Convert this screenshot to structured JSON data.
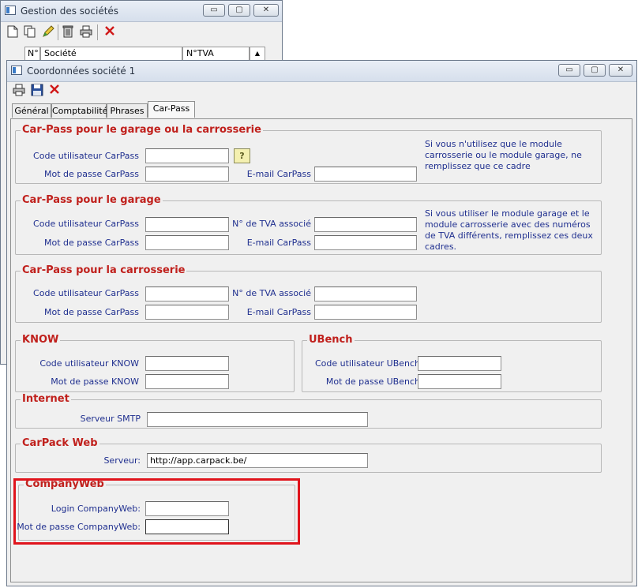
{
  "back_window": {
    "title": "Gestion des sociétés",
    "controls": {
      "minimize": "▭",
      "maximize": "▢",
      "close": "✕"
    },
    "grid_headers": [
      "N°",
      "Société",
      "N°TVA"
    ]
  },
  "front_window": {
    "title": "Coordonnées société 1",
    "controls": {
      "minimize": "▭",
      "maximize": "▢",
      "close": "✕"
    },
    "tabs": [
      {
        "label": "Général"
      },
      {
        "label": "Comptabilité"
      },
      {
        "label": "Phrases"
      },
      {
        "label": "Car-Pass",
        "active": true
      }
    ],
    "groups": {
      "carpass_both": {
        "title": "Car-Pass pour le garage ou la carrosserie",
        "user_label": "Code utilisateur CarPass",
        "user_value": "",
        "password_label": "Mot de passe CarPass",
        "password_value": "",
        "email_label": "E-mail CarPass",
        "email_value": "",
        "help_button": "?",
        "note": "Si vous n'utilisez que le module carrosserie ou le module garage, ne remplissez que ce cadre"
      },
      "carpass_garage": {
        "title": "Car-Pass pour le garage",
        "user_label": "Code utilisateur CarPass",
        "user_value": "",
        "password_label": "Mot de passe CarPass",
        "password_value": "",
        "vat_label": "N° de TVA associé",
        "vat_value": "",
        "email_label": "E-mail CarPass",
        "email_value": "",
        "note": "Si vous utiliser le module garage et le module carrosserie avec des numéros de TVA différents, remplissez ces deux cadres."
      },
      "carpass_body": {
        "title": "Car-Pass pour la carrosserie",
        "user_label": "Code utilisateur CarPass",
        "user_value": "",
        "password_label": "Mot de passe CarPass",
        "password_value": "",
        "vat_label": "N° de TVA associé",
        "vat_value": "",
        "email_label": "E-mail CarPass",
        "email_value": ""
      },
      "know": {
        "title": "KNOW",
        "user_label": "Code utilisateur KNOW",
        "user_value": "",
        "password_label": "Mot de passe KNOW",
        "password_value": ""
      },
      "ubench": {
        "title": "UBench",
        "user_label": "Code utilisateur UBench",
        "user_value": "",
        "password_label": "Mot de passe UBench",
        "password_value": ""
      },
      "internet": {
        "title": "Internet",
        "smtp_label": "Serveur SMTP",
        "smtp_value": ""
      },
      "carpack": {
        "title": "CarPack Web",
        "server_label": "Serveur:",
        "server_value": "http://app.carpack.be/"
      },
      "companyweb": {
        "title": "CompanyWeb",
        "login_label": "Login CompanyWeb:",
        "login_value": "",
        "password_label": "Mot de passe CompanyWeb:",
        "password_value": ""
      }
    }
  },
  "colors": {
    "accent": "#c0201c",
    "label": "#1f2f8f",
    "highlight": "#e0141c"
  }
}
